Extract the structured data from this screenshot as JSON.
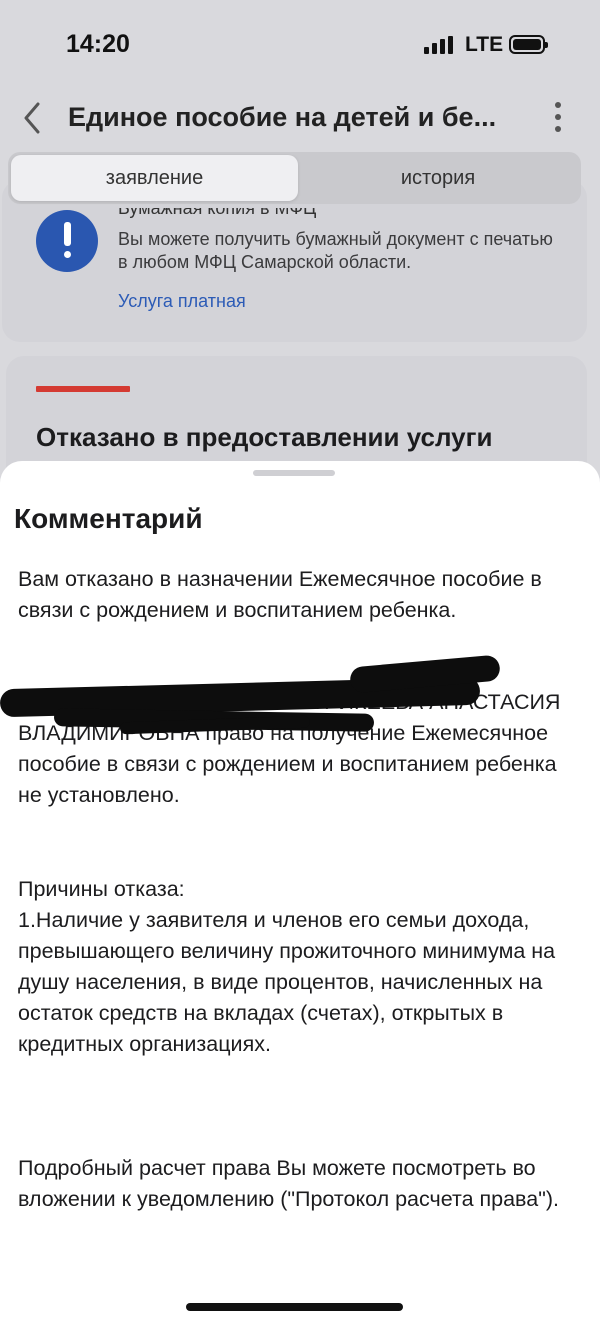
{
  "status_bar": {
    "time": "14:20",
    "network": "LTE"
  },
  "header": {
    "title": "Единое пособие на детей и бе..."
  },
  "tabs": [
    {
      "label": "заявление",
      "active": true
    },
    {
      "label": "история",
      "active": false
    }
  ],
  "notice_card": {
    "title": "Бумажная копия в МФЦ",
    "text": "Вы можете получить бумажный документ с печатью в любом МФЦ Самарской области.",
    "link": "Услуга платная"
  },
  "status_card": {
    "title": "Отказано в предоставлении услуги",
    "accent_color": "#d43a32"
  },
  "comment_sheet": {
    "title": "Комментарий",
    "paragraph1": "Вам отказано в назначении Ежемесячное пособие в связи с рождением и воспитанием ребенка.",
    "paragraph2": "В отношении беременной ПАТРИКЕЕВА АНАСТАСИЯ ВЛАДИМИРОВНА право на получение Ежемесячное пособие в связи с рождением и воспитанием ребенка не установлено.",
    "paragraph3": "Причины отказа:\n1.Наличие у заявителя и членов его семьи дохода, превышающего величину прожиточного минимума на душу населения, в виде процентов, начисленных на остаток средств на вкладах (счетах), открытых в кредитных организациях.",
    "paragraph4": "Подробный расчет права Вы можете посмотреть во вложении к уведомлению (\"Протокол расчета права\")."
  },
  "colors": {
    "accent_blue": "#2a57b0",
    "link_blue": "#2c5bb6",
    "refusal_red": "#d43a32"
  }
}
